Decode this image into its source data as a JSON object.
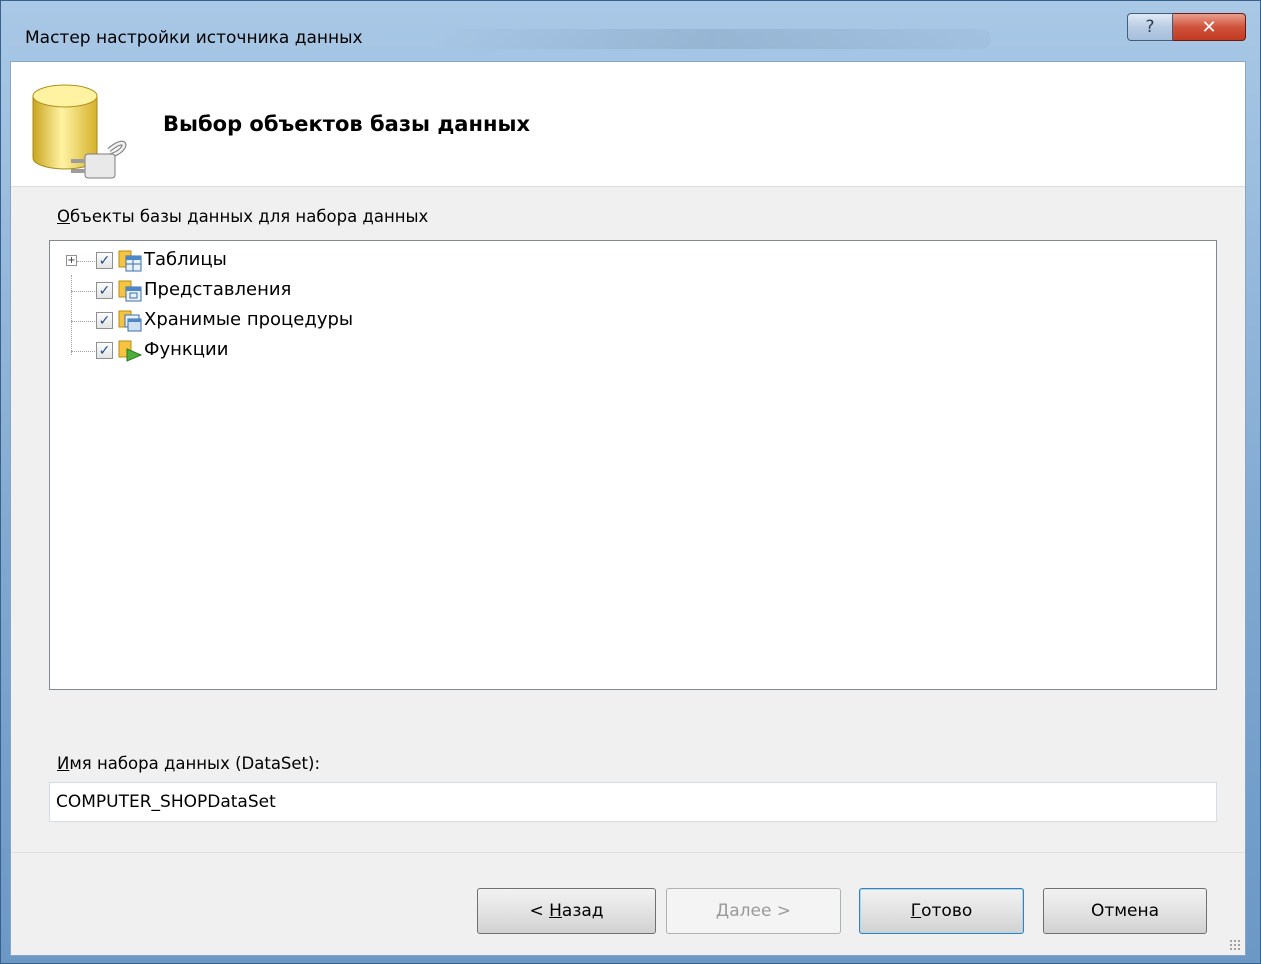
{
  "window": {
    "title": "Мастер настройки источника данных",
    "help_label": "?",
    "close_label": "✕"
  },
  "header": {
    "title": "Выбор объектов базы данных"
  },
  "objects": {
    "label_accesskey": "О",
    "label_rest": "бъекты базы данных для набора данных",
    "items": [
      {
        "label": "Таблицы",
        "checked": true,
        "expandable": true,
        "icon": "table-icon"
      },
      {
        "label": "Представления",
        "checked": true,
        "expandable": false,
        "icon": "view-icon"
      },
      {
        "label": "Хранимые процедуры",
        "checked": true,
        "expandable": false,
        "icon": "stored-procedure-icon"
      },
      {
        "label": "Функции",
        "checked": true,
        "expandable": false,
        "icon": "function-icon"
      }
    ],
    "expander_symbol": "+",
    "check_symbol": "✓"
  },
  "dataset": {
    "label_accesskey": "И",
    "label_rest": "мя набора данных (DataSet):",
    "value": "COMPUTER_SHOPDataSet"
  },
  "buttons": {
    "back_prefix": "< ",
    "back_accesskey": "Н",
    "back_rest": "азад",
    "next_accesskey": "Д",
    "next_rest": "алее >",
    "finish_accesskey": "Г",
    "finish_rest": "отово",
    "cancel": "Отмена"
  }
}
